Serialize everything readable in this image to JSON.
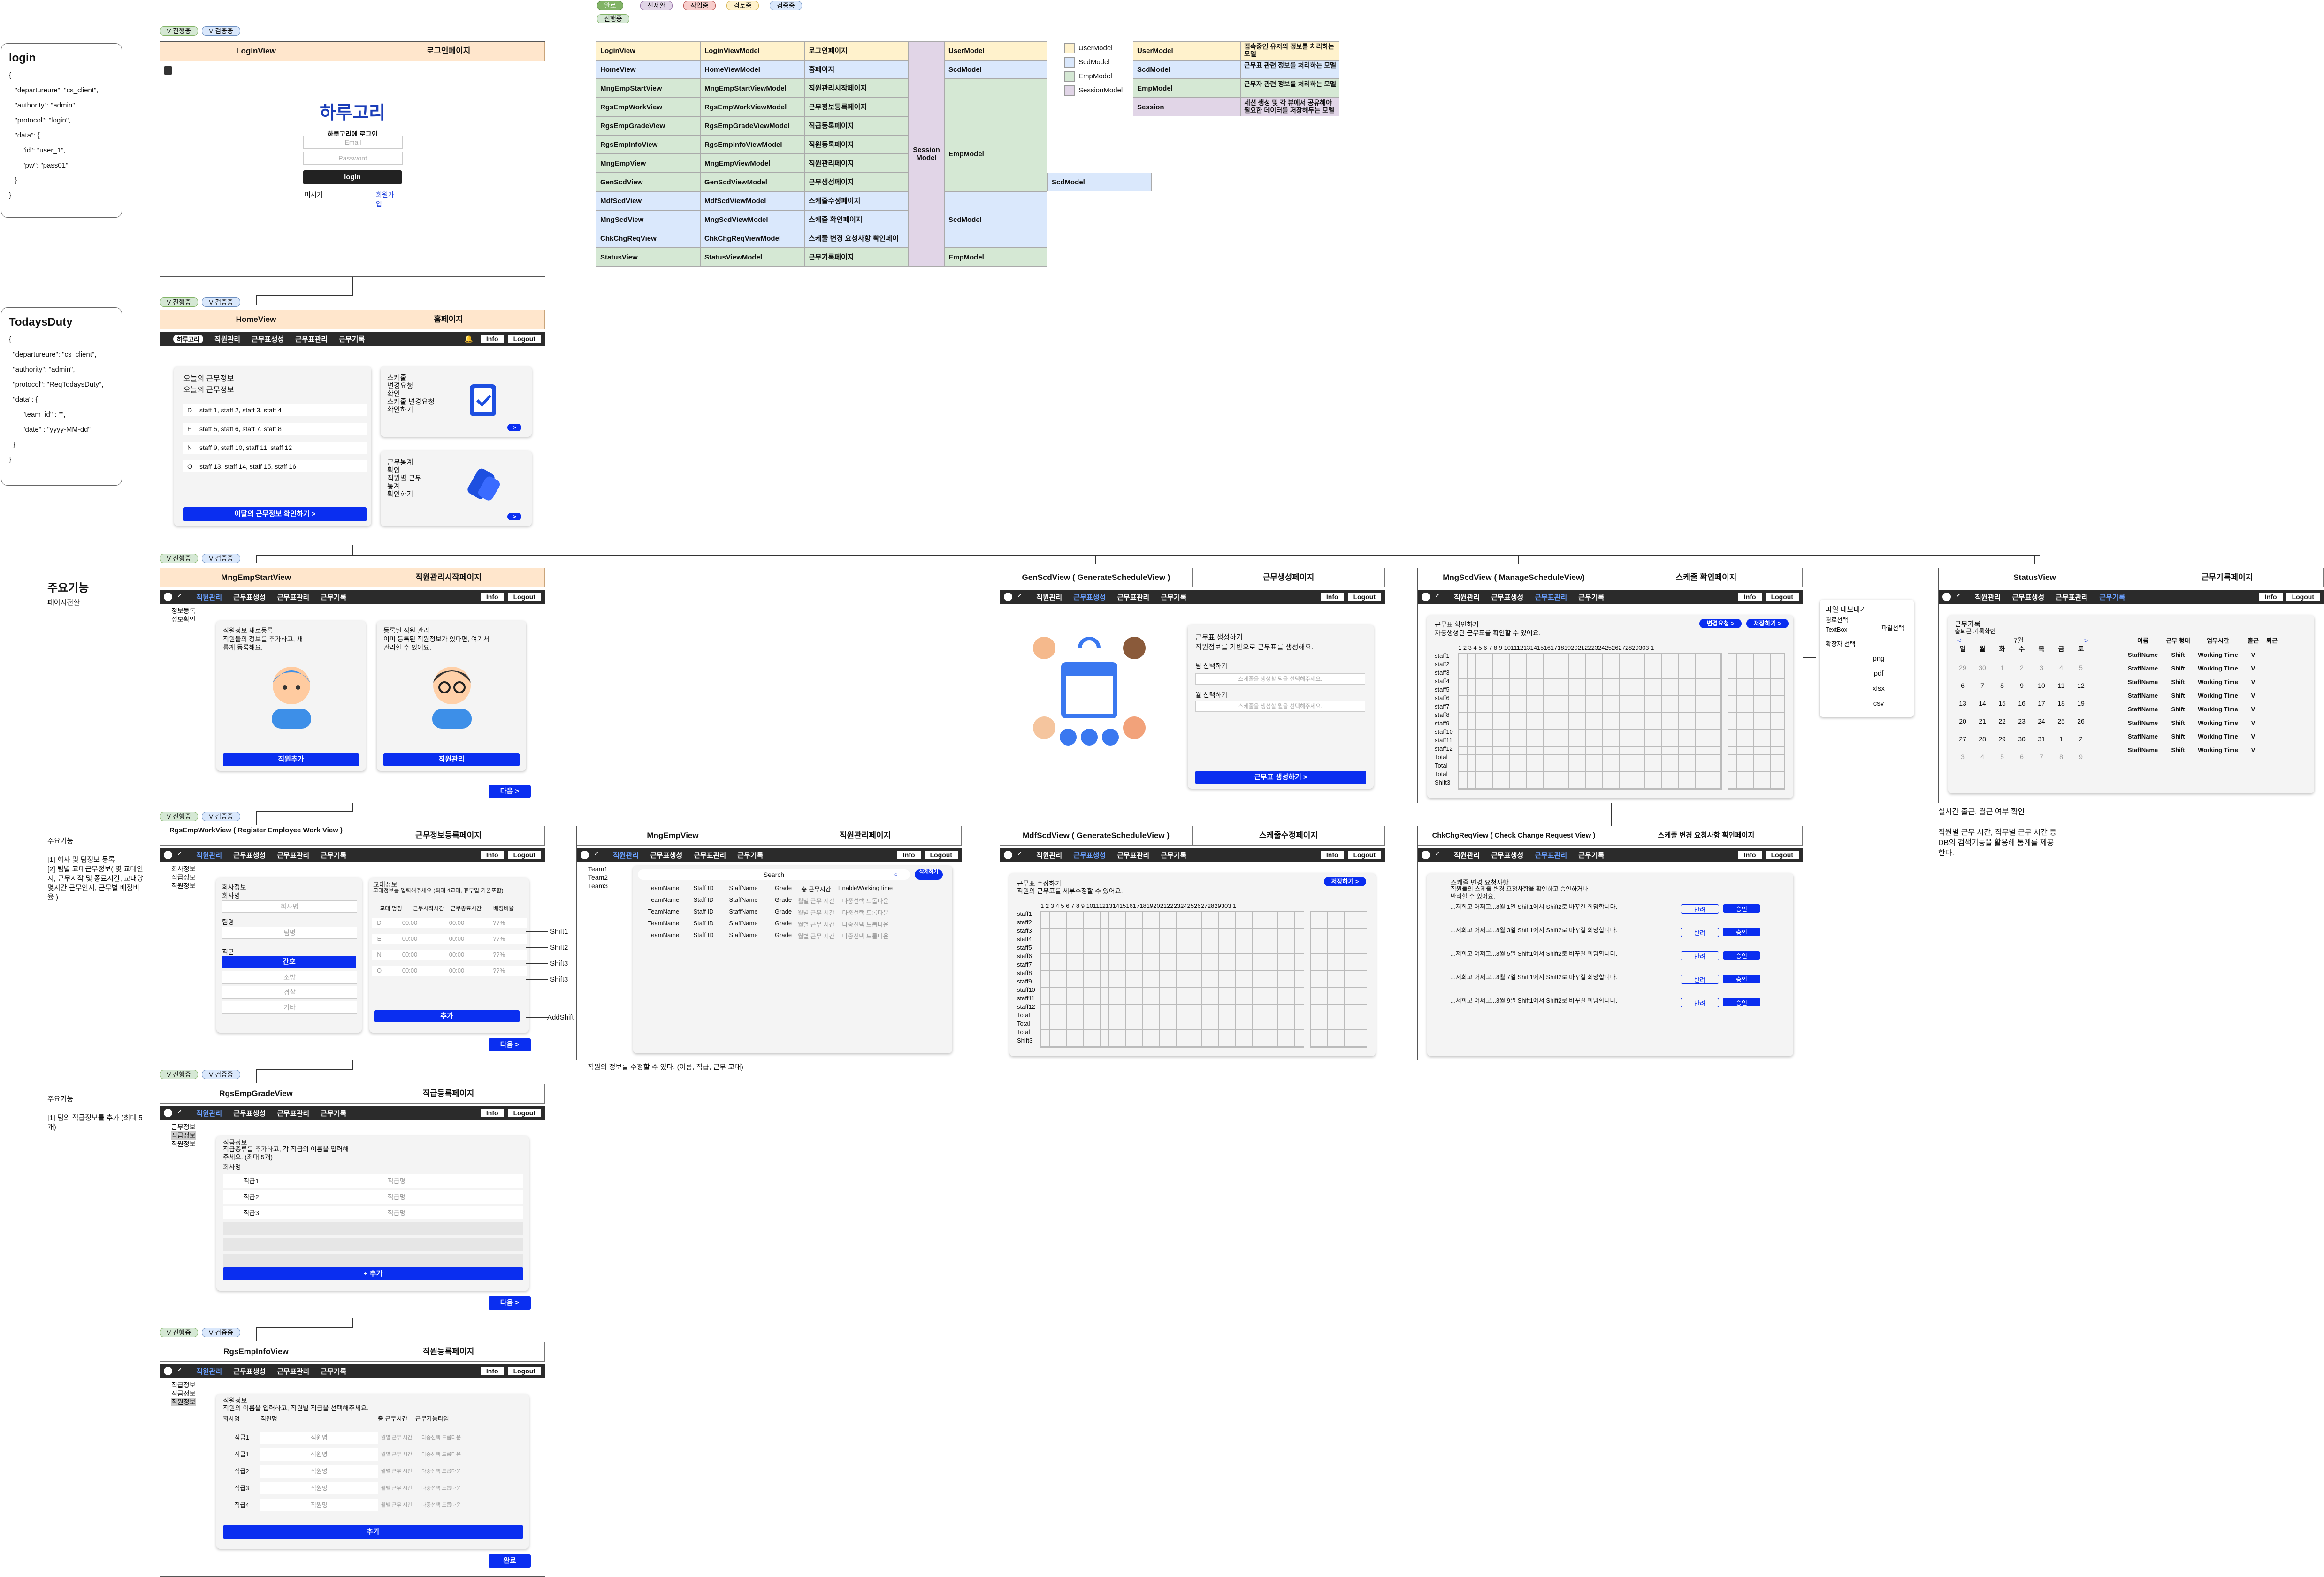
{
  "legend_top": {
    "items": [
      "완료",
      "선서완",
      "작업중",
      "검토중",
      "검증중",
      "진행중"
    ],
    "colors": [
      "#82b366",
      "#e1d5e7",
      "#f8cecc",
      "#fff2cc",
      "#dae8fc",
      "#d5e8d4"
    ]
  },
  "tags": {
    "progress": "V 진행중",
    "review": "V 검증중"
  },
  "json_login": {
    "title": "login",
    "body": "{\n   \"departureure\": \"cs_client\",\n   \"authority\": \"admin\",\n   \"protocol\": \"login\",\n   \"data\": {\n       \"id\": \"user_1\",\n       \"pw\": \"pass01\"\n   }\n}"
  },
  "json_today": {
    "title": "TodaysDuty",
    "body": "{\n  \"departureure\": \"cs_client\",\n  \"authority\": \"admin\",\n  \"protocol\": \"ReqTodaysDuty\",\n  \"data\": {\n       \"team_id\" : \"\",\n       \"date\" : \"yyyy-MM-dd\"\n  }\n}"
  },
  "nav": {
    "menus": [
      "직원관리",
      "근무표생성",
      "근무표관리",
      "근무기록"
    ],
    "info": "Info",
    "logout": "Logout"
  },
  "login": {
    "view": "LoginView",
    "page": "로그인페이지",
    "logo": "하루고리",
    "subtitle": "하루고리에 로그인",
    "email": "Email",
    "password": "Password",
    "btn": "login",
    "help": "머시기",
    "signup": "회원가입"
  },
  "home": {
    "view": "HomeView",
    "page": "홈페이지",
    "badge": "하루고리",
    "today_title": "오늘의 근무정보",
    "today_sub": "오늘의 근무정보",
    "rows": [
      {
        "k": "D",
        "v": "staff 1, staff 2, staff 3, staff 4"
      },
      {
        "k": "E",
        "v": "staff 5, staff 6, staff 7, staff 8"
      },
      {
        "k": "N",
        "v": "staff 9, staff 10, staff 11, staff 12"
      },
      {
        "k": "O",
        "v": "staff 13, staff 14, staff 15, staff 16"
      }
    ],
    "month_btn": "이달의 근무정보 확인하기  >",
    "card1": "스케줄\n변경요청\n확인\n스케줄 변경요청\n확인하기",
    "card2": "근무통계\n확인\n직원별 근무\n통계\n확인하기",
    "go": ">"
  },
  "main_feature": {
    "title": "주요기능",
    "desc": "페이지전환"
  },
  "mng_start": {
    "view": "MngEmpStartView",
    "page": "직원관리시작페이지",
    "side": [
      "정보등록",
      "정보확인"
    ],
    "c1": "직원정보 새로등록\n직원들의 정보를 추가하고, 새\n롭게 등록해요.",
    "c2": "등록된 직원 관리\n이미 등록된 직원정보가 있다면, 여기서\n관리할 수 있어요.",
    "b1": "직원추가",
    "b2": "직원관리",
    "next": "다음 >"
  },
  "gen": {
    "view": "GenScdView ( GenerateScheduleView )",
    "page": "근무생성페이지",
    "title": "근무표 생성하기",
    "sub": "직원정보를 기반으로 근무표를 생성해요.",
    "team": "팀 선택하기",
    "team_ph": "스케줄을 생성할 팀을 선택해주세요.",
    "month": "월 선택하기",
    "month_ph": "스케줄을 생성할 월을 선택해주세요.",
    "btn": "근무표 생성하기 >"
  },
  "mng_scd": {
    "view": "MngScdView ( ManageScheduleView)",
    "page": "스케줄 확인페이지",
    "title": "근무표 확인하기",
    "sub": "자동생성된 근무표를 확인할 수 있어요.",
    "b1": "변경요청 >",
    "b2": "저장하기 >",
    "staff": [
      "staff1",
      "staff2",
      "staff3",
      "staff4",
      "staff5",
      "staff6",
      "staff7",
      "staff8",
      "staff9",
      "staff10",
      "staff11",
      "staff12",
      "Total",
      "Total",
      "Total",
      "Shift3"
    ],
    "days": "1 2 3 4 5 6 7 8 9 1011121314151617181920212223242526272829303 1"
  },
  "export": {
    "title": "파일 내보내기",
    "sub": "경로선택",
    "box": "TextBox",
    "btn": "파일선택",
    "ext": "확장자 선택",
    "opts": [
      "png",
      "pdf",
      "xlsx",
      "csv"
    ]
  },
  "status": {
    "view": "StatusView",
    "page": "근무기록페이지",
    "title": "근무기록",
    "sub": "출퇴근 기록확인",
    "month": "7월",
    "week": [
      "일",
      "월",
      "화",
      "수",
      "목",
      "금",
      "토"
    ],
    "cal": [
      [
        "29",
        "30",
        "1",
        "2",
        "3",
        "4",
        "5"
      ],
      [
        "6",
        "7",
        "8",
        "9",
        "10",
        "11",
        "12"
      ],
      [
        "13",
        "14",
        "15",
        "16",
        "17",
        "18",
        "19"
      ],
      [
        "20",
        "21",
        "22",
        "23",
        "24",
        "25",
        "26"
      ],
      [
        "27",
        "28",
        "29",
        "30",
        "31",
        "1",
        "2"
      ],
      [
        "3",
        "4",
        "5",
        "6",
        "7",
        "8",
        "9"
      ]
    ],
    "cols": [
      "이름",
      "근무 형태",
      "업무시간",
      "출근",
      "퇴근"
    ],
    "row": [
      "StaffName",
      "Shift",
      "Working Time",
      "V",
      ""
    ],
    "note": "실시간 출근, 결근 여부 확인\n\n직원별 근무 시간, 직무별 근무 시간 등\nDB의 검색기능을 활용해 통계를 제공\n한다."
  },
  "rgs_work": {
    "view": "RgsEmpWorkView ( Register Employee Work View )",
    "page": "근무정보등록페이지",
    "desc": "주요기능\n\n[1] 회사 및 팀정보 등록\n[2] 팀별 교대근무정보( 몇 교대인\n지, 근무시작 및 종료시간, 교대당\n몇시간 근무인지, 근무별 배정비\n율 )",
    "side": [
      "회사정보",
      "직급정보",
      "직원정보"
    ],
    "company": "회사정보",
    "company_label": "회사명",
    "company_ph": "회사명",
    "team": "팀명",
    "team_ph": "팀명",
    "job": "직군",
    "jobs": [
      "간호",
      "소방",
      "경찰",
      "기타"
    ],
    "shift_title": "교대정보",
    "shift_desc": "교대정보를 입력해주세요 (최대 4교대, 휴무일 기본포함)",
    "cols": [
      "교대 명칭",
      "근무시작시간",
      "근무종료시간",
      "배정비율"
    ],
    "shifts": [
      {
        "k": "D",
        "a": "00:00",
        "b": "00:00",
        "p": "??%",
        "o": "Shift1"
      },
      {
        "k": "E",
        "a": "00:00",
        "b": "00:00",
        "p": "??%",
        "o": "Shift2"
      },
      {
        "k": "N",
        "a": "00:00",
        "b": "00:00",
        "p": "??%",
        "o": "Shift3"
      },
      {
        "k": "O",
        "a": "00:00",
        "b": "00:00",
        "p": "??%",
        "o": "Shift3"
      }
    ],
    "add": "추가",
    "add_out": "AddShift",
    "next": "다음 >"
  },
  "mng_emp": {
    "view": "MngEmpView",
    "page": "직원관리페이지",
    "teams": [
      "Team1",
      "Team2",
      "Team3"
    ],
    "search": "Search",
    "del": "삭제하기",
    "cols": [
      "TeamName",
      "Staff ID",
      "StaffName",
      "Grade",
      "총 근무시간",
      "EnableWorkingTime"
    ],
    "row": [
      "TeamName",
      "Staff ID",
      "StaffName",
      "Grade",
      "월별 근무 시간",
      "다중선택 드롭다운"
    ],
    "note": "직원의 정보를 수정할 수 있다. (이름, 직급, 근무 교대)"
  },
  "mdf": {
    "view": "MdfScdView ( GenerateScheduleView )",
    "page": "스케줄수정페이지",
    "title": "근무표 수정하기",
    "sub": "직원의 근무표를 세부수정할 수 있어요.",
    "save": "저장하기 >"
  },
  "chk": {
    "view": "ChkChgReqView ( Check Change Request View )",
    "page": "스케줄 변경 요청사항 확인페이지",
    "title": "스케줄 변경 요청사항",
    "sub": "직원들의 스케줄 변경 요청사항을 확인하고 승인하거나 반려할 수 있어요.",
    "reqs": [
      "...저희고 어쩌고...8월 1일 Shift1에서 Shift2로 바꾸길 희망합니다.",
      "...저희고 어쩌고...8월 3일 Shift1에서 Shift2로 바꾸길 희망합니다.",
      "...저희고 어쩌고...8월 5일 Shift1에서 Shift2로 바꾸길 희망합니다.",
      "...저희고 어쩌고...8월 7일 Shift1에서 Shift2로 바꾸길 희망합니다.",
      "...저희고 어쩌고...8월 9일 Shift1에서 Shift2로 바꾸길 희망합니다."
    ],
    "reject": "반려",
    "approve": "승인"
  },
  "rgs_grade": {
    "view": "RgsEmpGradeView",
    "page": "직급등록페이지",
    "desc": "주요기능\n\n[1] 팀의 직급정보를 추가 (최대 5\n개)",
    "side": [
      "근무정보",
      "직급정보",
      "직원정보"
    ],
    "title": "직급정보",
    "sub": "직급종류를 추가하고, 각 직급의 이름을 입력해\n주세요. (최대 5개)",
    "label": "회사명",
    "grades": [
      "직급1",
      "직급2",
      "직급3"
    ],
    "ph": "직급명",
    "add": "+ 추가",
    "next": "다음 >"
  },
  "rgs_info": {
    "view": "RgsEmpInfoView",
    "page": "직원등록페이지",
    "side": [
      "직급정보",
      "직급정보",
      "직원정보"
    ],
    "title": "직원정보",
    "sub": "직원의 이름을 입력하고, 직원별 직급을 선택해주세요.",
    "cols": [
      "회사명",
      "직원명",
      "총 근무시간",
      "근무가능타임"
    ],
    "grades": [
      "직급1",
      "직급1",
      "직급2",
      "직급3",
      "직급4"
    ],
    "ph": "직원명",
    "ph2": "월별 근무 시간",
    "ph3": "다중선택 드롭다운",
    "add": "추가",
    "done": "완료"
  },
  "mvvm": {
    "rows": [
      [
        "LoginView",
        "LoginViewModel",
        "로그인페이지"
      ],
      [
        "HomeView",
        "HomeViewModel",
        "홈페이지"
      ],
      [
        "MngEmpStartView",
        "MngEmpStartViewModel",
        "직원관리시작페이지"
      ],
      [
        "RgsEmpWorkView",
        "RgsEmpWorkViewModel",
        "근무정보등록페이지"
      ],
      [
        "RgsEmpGradeView",
        "RgsEmpGradeViewModel",
        "직급등록페이지"
      ],
      [
        "RgsEmpInfoView",
        "RgsEmpInfoViewModel",
        "직원등록페이지"
      ],
      [
        "MngEmpView",
        "MngEmpViewModel",
        "직원관리페이지"
      ],
      [
        "GenScdView",
        "GenScdViewModel",
        "근무생성페이지"
      ],
      [
        "MdfScdView",
        "MdfScdViewModel",
        "스케줄수정페이지"
      ],
      [
        "MngScdView",
        "MngScdViewModel",
        "스케줄 확인페이지"
      ],
      [
        "ChkChgReqView",
        "ChkChgReqViewModel",
        "스케줄 변경 요청사항 확인페이지"
      ],
      [
        "StatusView",
        "StatusViewModel",
        "근무기록페이지"
      ]
    ],
    "session": "Session\nModel",
    "models": [
      "UserModel",
      "ScdModel",
      "EmpModel",
      "ScdModel",
      "EmpModel"
    ],
    "extra": "ScdModel"
  },
  "model_legend": [
    "UserModel",
    "ScdModel",
    "EmpModel",
    "SessionModel"
  ],
  "model_desc": [
    [
      "UserModel",
      "접속중인 유저의 정보를 처리하는 모델"
    ],
    [
      "ScdModel",
      "근무표 관련 정보를 처리하는 모델"
    ],
    [
      "EmpModel",
      "근무자 관련 정보를 처리하는 모델"
    ],
    [
      "Session",
      "세션 생성 및 각 뷰에서 공유해야 필요한 데이터를 저장해두는 모델"
    ]
  ]
}
